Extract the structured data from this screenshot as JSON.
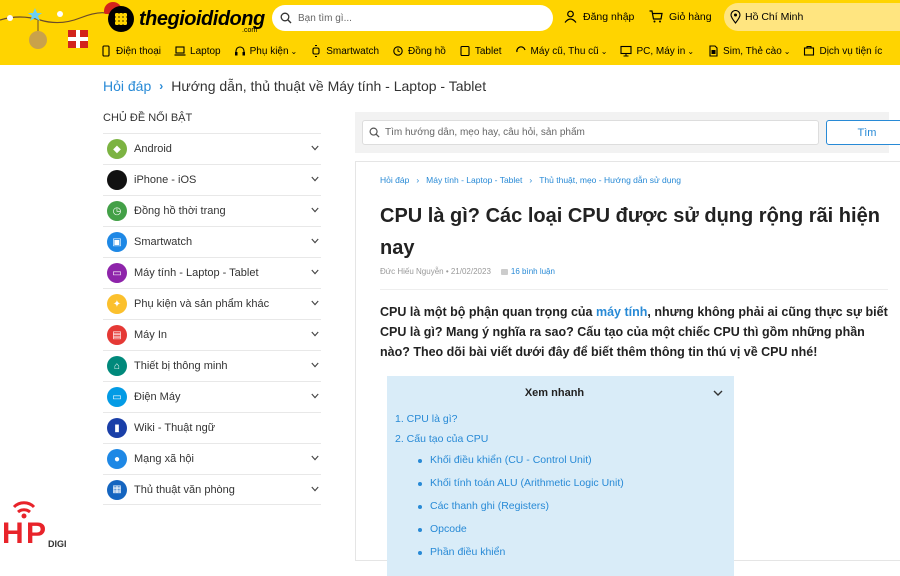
{
  "header": {
    "logo_text": "thegioididong",
    "logo_sub": ".com",
    "search_placeholder": "Bạn tìm gì...",
    "login_label": "Đăng nhập",
    "cart_label": "Giỏ hàng",
    "location_label": "Hồ Chí Minh",
    "brand_color": "#ffd400"
  },
  "nav": [
    {
      "label": "Điện thoại",
      "icon": "phone-icon",
      "dropdown": false
    },
    {
      "label": "Laptop",
      "icon": "laptop-icon",
      "dropdown": false
    },
    {
      "label": "Phụ kiện",
      "icon": "headphone-icon",
      "dropdown": true
    },
    {
      "label": "Smartwatch",
      "icon": "watch-icon",
      "dropdown": false
    },
    {
      "label": "Đồng hồ",
      "icon": "clock-icon",
      "dropdown": false
    },
    {
      "label": "Tablet",
      "icon": "tablet-icon",
      "dropdown": false
    },
    {
      "label": "Máy cũ, Thu cũ",
      "icon": "recycle-icon",
      "dropdown": true
    },
    {
      "label": "PC, Máy in",
      "icon": "pc-icon",
      "dropdown": true
    },
    {
      "label": "Sim, Thẻ cào",
      "icon": "sim-icon",
      "dropdown": true
    },
    {
      "label": "Dịch vụ tiện íc",
      "icon": "service-icon",
      "dropdown": false
    }
  ],
  "breadcrumb": {
    "root": "Hỏi đáp",
    "current": "Hướng dẫn, thủ thuật về Máy tính - Laptop - Tablet"
  },
  "sidebar": {
    "title": "Chủ đề nổi bật",
    "items": [
      {
        "label": "Android",
        "icon": "android-icon",
        "color": "#7cb342"
      },
      {
        "label": "iPhone - iOS",
        "icon": "apple-icon",
        "color": "#111111"
      },
      {
        "label": "Đồng hồ thời trang",
        "icon": "watch-icon",
        "color": "#43a047"
      },
      {
        "label": "Smartwatch",
        "icon": "smartwatch-icon",
        "color": "#1e88e5"
      },
      {
        "label": "Máy tính - Laptop - Tablet",
        "icon": "laptop-icon",
        "color": "#8e24aa"
      },
      {
        "label": "Phụ kiện và sản phẩm khác",
        "icon": "accessory-icon",
        "color": "#fbc02d"
      },
      {
        "label": "Máy In",
        "icon": "printer-icon",
        "color": "#e53935"
      },
      {
        "label": "Thiết bị thông minh",
        "icon": "smart-device-icon",
        "color": "#00897b"
      },
      {
        "label": "Điện Máy",
        "icon": "appliance-icon",
        "color": "#039be5"
      },
      {
        "label": "Wiki - Thuật ngữ",
        "icon": "book-icon",
        "color": "#1a3fa8"
      },
      {
        "label": "Mạng xã hội",
        "icon": "social-icon",
        "color": "#1e88e5"
      },
      {
        "label": "Thủ thuật văn phòng",
        "icon": "office-icon",
        "color": "#1565c0"
      }
    ]
  },
  "content_search": {
    "placeholder": "Tìm hướng dẫn, mẹo hay, câu hỏi, sản phẩm",
    "button_label": "Tìm"
  },
  "article": {
    "breadcrumb": [
      "Hỏi đáp",
      "Máy tính - Laptop - Tablet",
      "Thủ thuật, mẹo - Hướng dẫn sử dụng"
    ],
    "title": "CPU là gì? Các loại CPU được sử dụng rộng rãi hiện nay",
    "author": "Đức Hiếu Nguyễn",
    "date": "21/02/2023",
    "comments": "16 bình luận",
    "lead_before": "CPU là một bộ phận quan trọng của ",
    "lead_link": "máy tính",
    "lead_after": ", nhưng không phải ai cũng thực sự biết CPU là gì? Mang ý nghĩa ra sao? Cấu tạo của một chiếc CPU thì gồm những phần nào? Theo dõi bài viết dưới đây để biết thêm thông tin thú vị về CPU nhé!",
    "toc": {
      "title": "Xem nhanh",
      "items": [
        "1. CPU là gì?",
        "2. Cấu tạo của CPU"
      ],
      "subitems": [
        "Khối điều khiển (CU - Control Unit)",
        "Khối tính toán ALU (Arithmetic Logic Unit)",
        "Các thanh ghi (Registers)",
        "Opcode",
        "Phần điều khiển"
      ]
    }
  },
  "watermark": {
    "text": "DIGI"
  }
}
